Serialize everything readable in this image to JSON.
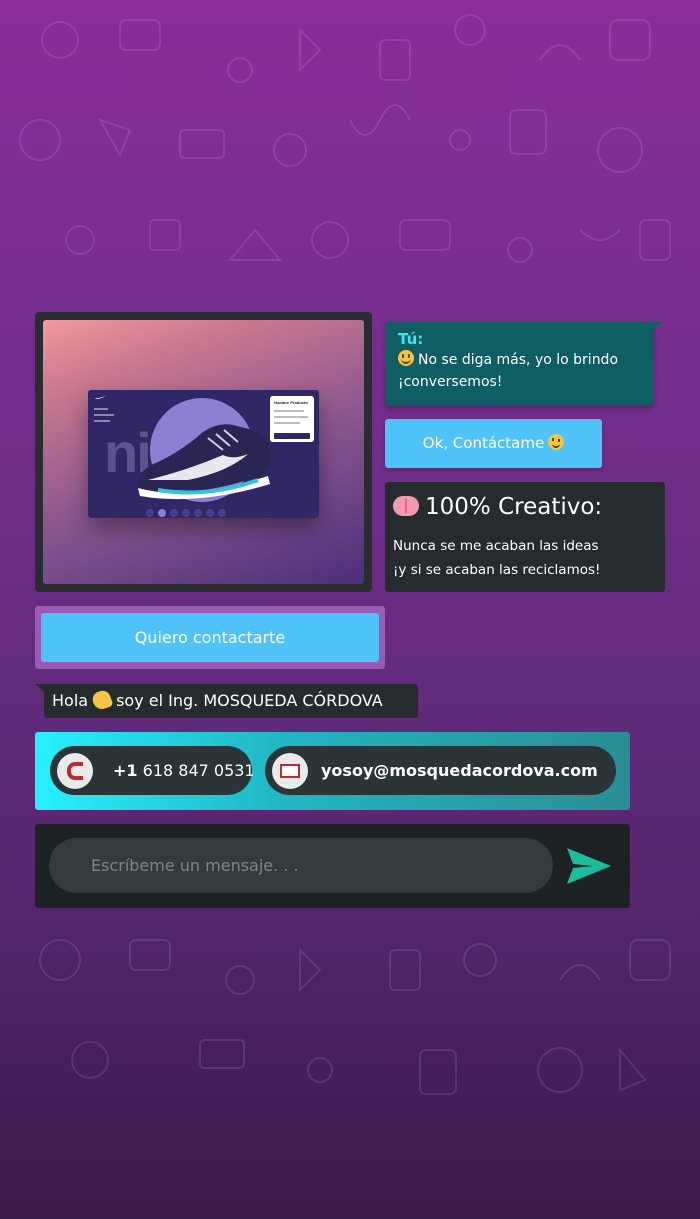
{
  "chat": {
    "tu_label": "Tú:",
    "tu_line1": "No se diga más, yo lo brindo",
    "tu_line2": "¡conversemos!",
    "ok_button": "Ok, Contáctame",
    "creative_title": "100% Creativo:",
    "creative_line1": "Nunca se me acaban las ideas",
    "creative_line2": "¡y si se acaban las reciclamos!",
    "quiero_button": "Quiero contactarte",
    "hola_prefix": "Hola",
    "hola_suffix": "soy el Ing. MOSQUEDA CÓRDOVA"
  },
  "preview": {
    "mock_title": "Nombre Producto",
    "mock_bigtext": "nike"
  },
  "contact": {
    "phone_prefix": "+1",
    "phone_number": "618 847 0531",
    "email": "yosoy@mosquedacordova.com"
  },
  "composer": {
    "placeholder": "Escríbeme un mensaje. . ."
  },
  "icons": {
    "send": "send-icon",
    "phone": "phone-icon",
    "email": "mail-icon"
  },
  "colors": {
    "accent_button": "#4fc3f7",
    "tu_bubble": "#0f5e63",
    "tu_label": "#3ee6ef",
    "dark_bubble": "#262b2d",
    "send_icon": "#1abc9c"
  }
}
